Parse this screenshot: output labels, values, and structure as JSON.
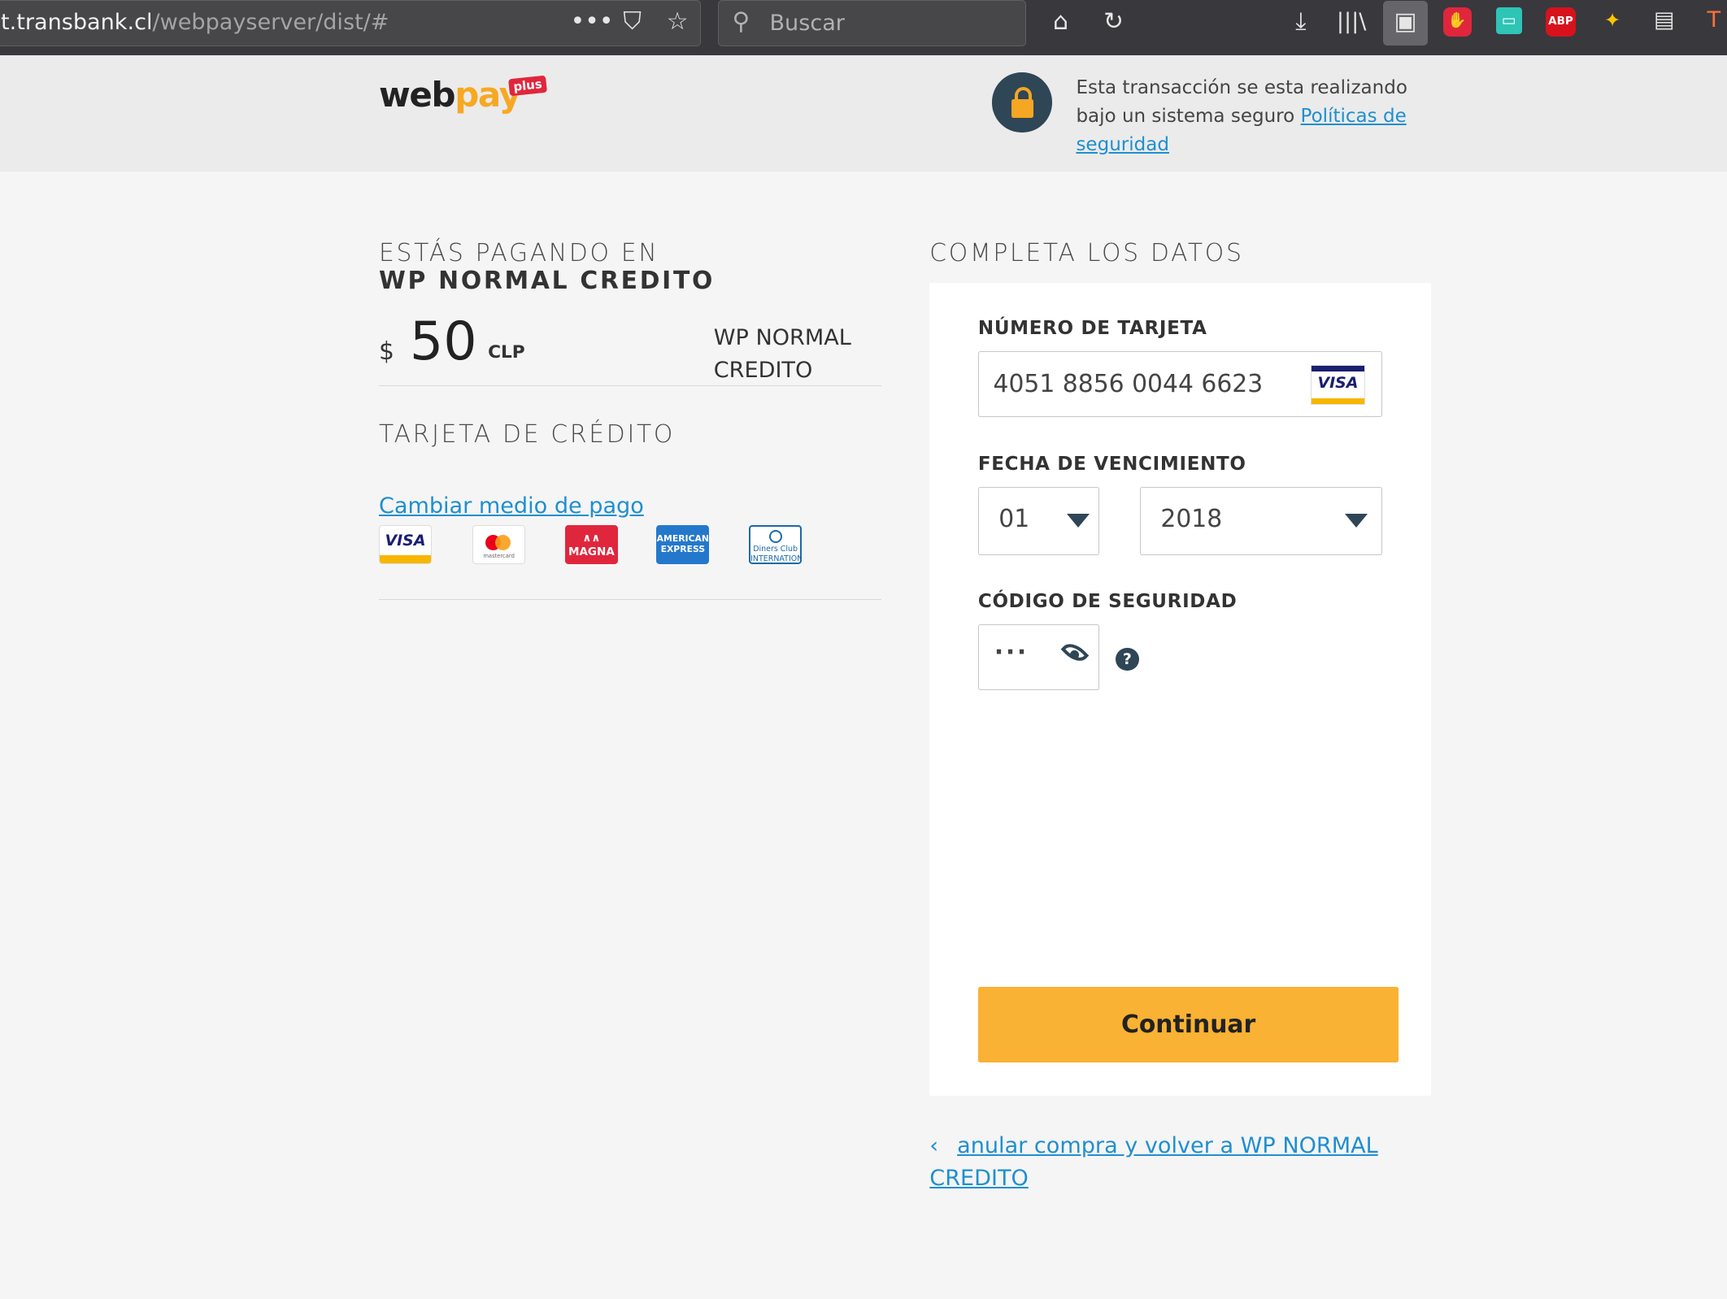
{
  "browser": {
    "url_host": "t.transbank.cl",
    "url_path": "/webpayserver/dist/#",
    "search_placeholder": "Buscar",
    "extensions": [
      "ABP"
    ]
  },
  "header": {
    "logo_web": "web",
    "logo_pay": "pay",
    "logo_plus": "plus",
    "secure_text": "Esta transacción se esta realizando bajo un sistema seguro ",
    "security_link": "Políticas de seguridad"
  },
  "summary": {
    "paying_label": "ESTÁS PAGANDO EN",
    "merchant": "WP NORMAL CREDITO",
    "currency_symbol": "$",
    "amount": "50",
    "currency": "CLP",
    "merchant_side": "WP NORMAL CREDITO",
    "method_label": "TARJETA DE CRÉDITO",
    "change_link": "Cambiar medio de pago",
    "brands": {
      "visa": "VISA",
      "mastercard": "mastercard",
      "magna": "MAGNA",
      "amex": "AMERICAN EXPRESS",
      "diners": "Diners Club INTERNATIONAL"
    }
  },
  "form": {
    "title": "COMPLETA LOS DATOS",
    "card_number_label": "NÚMERO DE TARJETA",
    "card_number": "4051 8856 0044 6623",
    "card_brand": "VISA",
    "expiry_label": "FECHA DE VENCIMIENTO",
    "month": "01",
    "year": "2018",
    "cvv_label": "CÓDIGO DE SEGURIDAD",
    "cvv_masked": "···",
    "help": "?",
    "continue": "Continuar",
    "cancel_link": "anular compra y volver a WP NORMAL CREDITO"
  }
}
